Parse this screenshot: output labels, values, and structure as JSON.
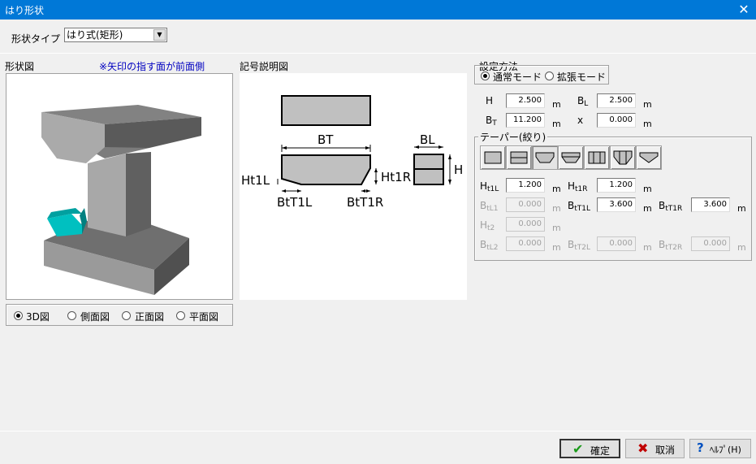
{
  "window": {
    "title": "はり形状",
    "close_glyph": "✕"
  },
  "shape_type": {
    "label": "形状タイプ",
    "value": "はり式(矩形)"
  },
  "shape_view": {
    "label": "形状図",
    "note": "※矢印の指す面が前面側"
  },
  "view_options": [
    {
      "label": "3D図",
      "selected": true
    },
    {
      "label": "側面図",
      "selected": false
    },
    {
      "label": "正面図",
      "selected": false
    },
    {
      "label": "平面図",
      "selected": false
    }
  ],
  "legend_panel": {
    "label": "記号説明図",
    "labels": {
      "bt": "BT",
      "bl": "BL",
      "h": "H",
      "ht1l": "Ht1L",
      "ht1r": "Ht1R",
      "btt1l": "BtT1L",
      "btt1r": "BtT1R"
    }
  },
  "settings": {
    "method_label": "設定方法",
    "modes": [
      {
        "label": "通常モード",
        "selected": true
      },
      {
        "label": "拡張モード",
        "selected": false
      }
    ],
    "fields": {
      "h": {
        "label": "H",
        "value": "2.500",
        "unit": "m"
      },
      "bl": {
        "label": "B",
        "sub": "L",
        "value": "2.500",
        "unit": "m"
      },
      "bt": {
        "label": "B",
        "sub": "T",
        "value": "11.200",
        "unit": "m"
      },
      "x": {
        "label": "x",
        "value": "0.000",
        "unit": "m"
      }
    },
    "taper": {
      "label": "テーパー(絞り)",
      "selected_index": 2,
      "icons": [
        "taper-none-icon",
        "taper-split-icon",
        "taper-bottom-icon",
        "taper-both-icon",
        "taper-vertical-icon",
        "taper-v-bottom-icon",
        "taper-v-full-icon"
      ],
      "fields": {
        "ht1l": {
          "label": "H",
          "sub": "t1L",
          "value": "1.200",
          "unit": "m",
          "enabled": true
        },
        "ht1r": {
          "label": "H",
          "sub": "t1R",
          "value": "1.200",
          "unit": "m",
          "enabled": true
        },
        "btl1": {
          "label": "B",
          "sub": "tL1",
          "value": "0.000",
          "unit": "m",
          "enabled": false
        },
        "btt1l": {
          "label": "B",
          "sub": "tT1L",
          "value": "3.600",
          "unit": "m",
          "enabled": true
        },
        "btt1r": {
          "label": "B",
          "sub": "tT1R",
          "value": "3.600",
          "unit": "m",
          "enabled": true
        },
        "ht2": {
          "label": "H",
          "sub": "t2",
          "value": "0.000",
          "unit": "m",
          "enabled": false
        },
        "btl2": {
          "label": "B",
          "sub": "tL2",
          "value": "0.000",
          "unit": "m",
          "enabled": false
        },
        "btt2l": {
          "label": "B",
          "sub": "tT2L",
          "value": "0.000",
          "unit": "m",
          "enabled": false
        },
        "btt2r": {
          "label": "B",
          "sub": "tT2R",
          "value": "0.000",
          "unit": "m",
          "enabled": false
        }
      }
    }
  },
  "buttons": {
    "ok": "確定",
    "cancel": "取消",
    "help": "ﾍﾙﾌﾟ(H)"
  },
  "colors": {
    "titlebar": "#0078d7",
    "accent": "#00c0c0",
    "note": "#0000c0"
  }
}
